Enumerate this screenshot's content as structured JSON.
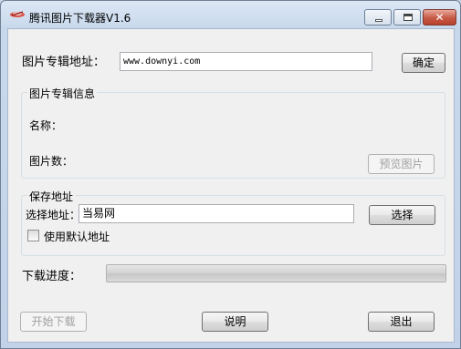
{
  "window": {
    "title": "腾讯图片下载器V1.6",
    "close_glyph": "✕"
  },
  "album_url": {
    "label": "图片专辑地址：",
    "value": "www.downyi.com",
    "confirm_label": "确定"
  },
  "album_info": {
    "group_title": "图片专辑信息",
    "name_label": "名称：",
    "name_value": "",
    "count_label": "图片数：",
    "count_value": "",
    "preview_label": "预览图片"
  },
  "save": {
    "group_title": "保存地址",
    "path_label": "选择地址：",
    "path_value": "当易网",
    "browse_label": "选择",
    "default_label": "使用默认地址",
    "default_checked": false
  },
  "progress": {
    "label": "下载进度：",
    "value_percent": 0
  },
  "footer": {
    "start_label": "开始下载",
    "help_label": "说明",
    "exit_label": "退出"
  },
  "colors": {
    "titlebar": "#c8d8ec",
    "client_bg": "#f0f0f0",
    "close_button": "#c65a45",
    "progress_fill": "#37c13a"
  }
}
